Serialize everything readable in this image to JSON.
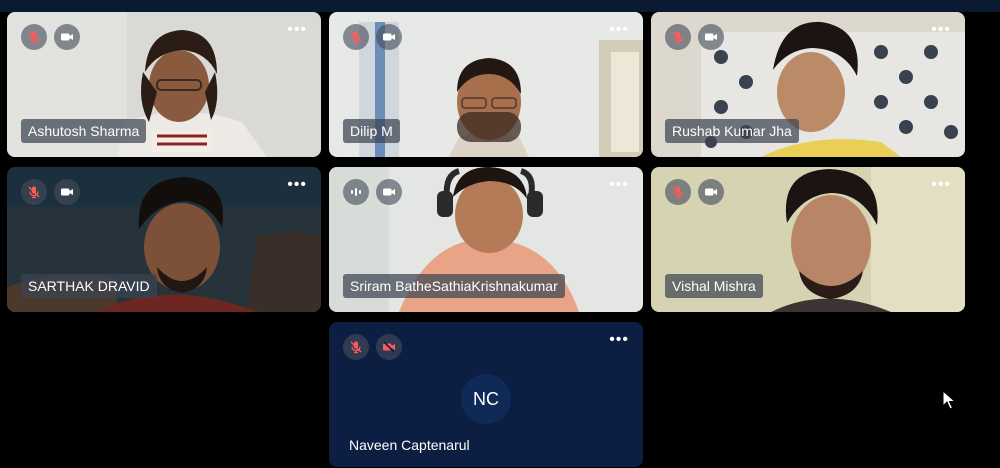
{
  "participants": [
    {
      "name": "Ashutosh Sharma",
      "mic": "muted",
      "camera": "on"
    },
    {
      "name": "Dilip M",
      "mic": "muted",
      "camera": "on"
    },
    {
      "name": "Rushab Kumar Jha",
      "mic": "muted",
      "camera": "on"
    },
    {
      "name": "SARTHAK DRAVID",
      "mic": "muted",
      "camera": "on"
    },
    {
      "name": "Sriram BatheSathiaKrishnakumar",
      "mic": "speaking",
      "camera": "on"
    },
    {
      "name": "Vishal Mishra",
      "mic": "muted",
      "camera": "on"
    },
    {
      "name": "Naveen Captenarul",
      "mic": "muted",
      "camera": "off",
      "initials": "NC"
    }
  ],
  "more_label": "•••",
  "icons": {
    "mic_muted": "mic-off-icon",
    "mic_active": "mic-speaking-icon",
    "camera_on": "video-camera-icon",
    "camera_off": "video-camera-off-icon",
    "more": "more-options-icon",
    "cursor": "mouse-pointer-icon"
  },
  "colors": {
    "background": "#000000",
    "top_bar": "#0b1a33",
    "avatar_tile": "#0c1e42",
    "avatar_circle": "#0f2a57",
    "muted_icon": "#ff5a5a"
  }
}
